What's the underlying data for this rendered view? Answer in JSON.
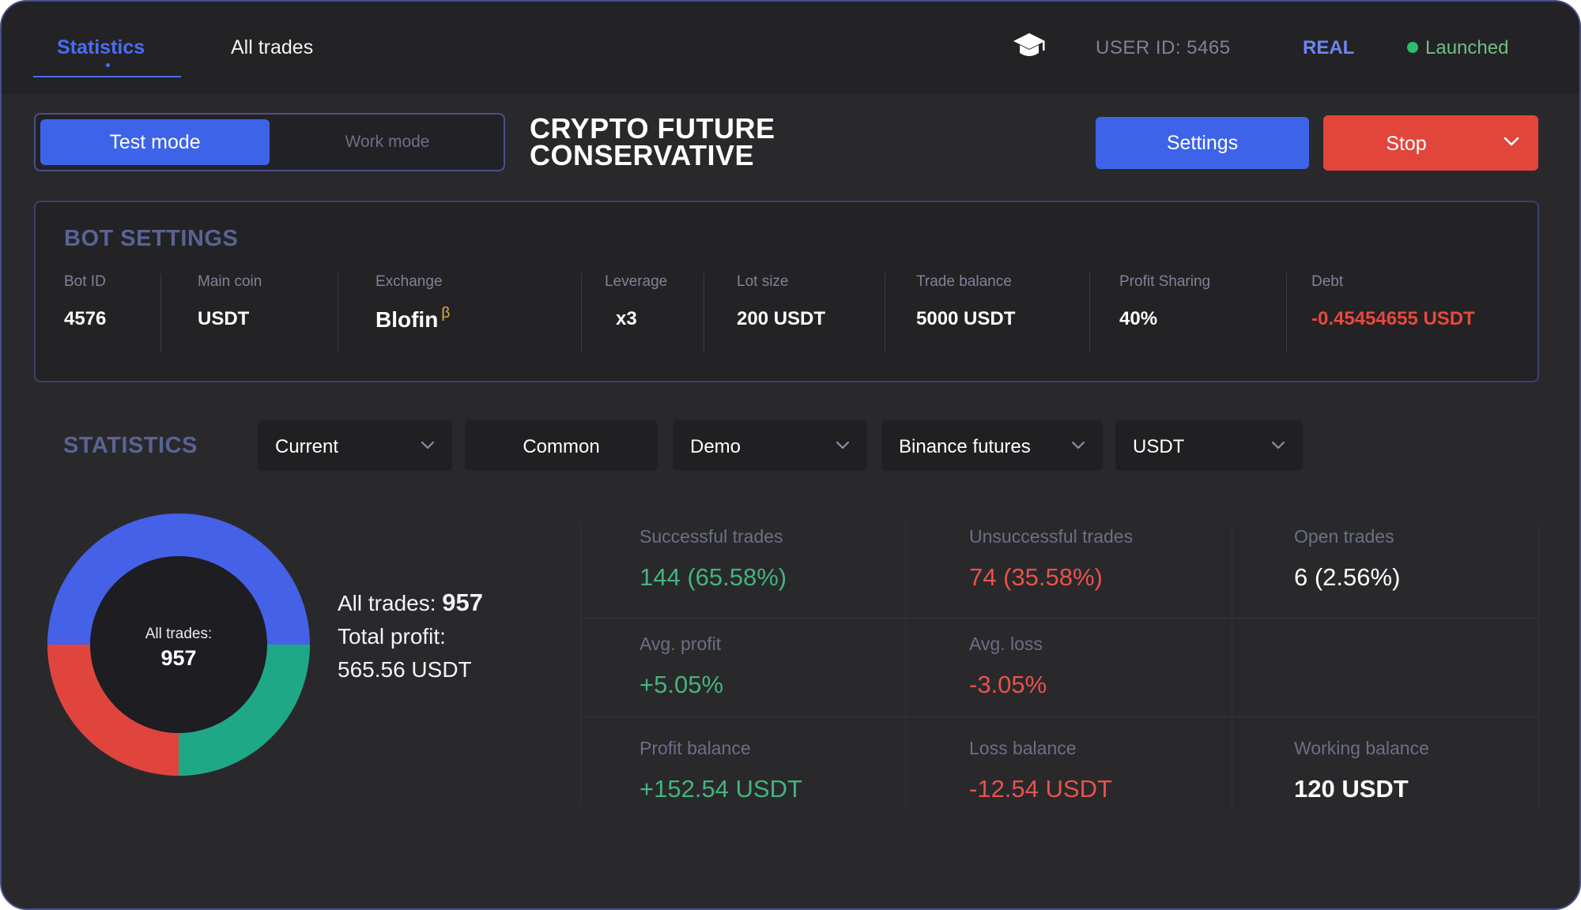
{
  "topbar": {
    "tabs": [
      {
        "label": "Statistics"
      },
      {
        "label": "All trades"
      }
    ],
    "user_id": "USER ID: 5465",
    "account_type": "REAL",
    "status": "Launched",
    "icons": {
      "education": "graduation-cap-icon",
      "status": "status-dot-icon"
    }
  },
  "header": {
    "modes": [
      {
        "label": "Test mode"
      },
      {
        "label": "Work mode"
      }
    ],
    "title_line1": "CRYPTO FUTURE",
    "title_line2": "CONSERVATIVE",
    "settings_label": "Settings",
    "stop_label": "Stop"
  },
  "bot_settings": {
    "title": "BOT SETTINGS",
    "fields": [
      {
        "label": "Bot ID",
        "value": "4576"
      },
      {
        "label": "Main coin",
        "value": "USDT"
      },
      {
        "label": "Exchange",
        "value": "Blofin",
        "badge": "β"
      },
      {
        "label": "Leverage",
        "value": "x3"
      },
      {
        "label": "Lot size",
        "value": "200 USDT"
      },
      {
        "label": "Trade balance",
        "value": "5000 USDT"
      },
      {
        "label": "Profit Sharing",
        "value": "40%"
      },
      {
        "label": "Debt",
        "value": "-0.45454655 USDT"
      }
    ]
  },
  "statistics": {
    "title": "STATISTICS",
    "filters": [
      {
        "label": "Current"
      },
      {
        "label": "Common"
      },
      {
        "label": "Demo"
      },
      {
        "label": "Binance futures"
      },
      {
        "label": "USDT"
      }
    ],
    "donut": {
      "label": "All trades:",
      "value": "957"
    },
    "totals": {
      "all_trades_label": "All trades:",
      "all_trades_value": "957",
      "profit_label": "Total profit:",
      "profit_value": "565.56 USDT"
    },
    "metrics": [
      {
        "label": "Successful trades",
        "value": "144 (65.58%)"
      },
      {
        "label": "Unsuccessful trades",
        "value": "74 (35.58%)"
      },
      {
        "label": "Open trades",
        "value": "6 (2.56%)"
      },
      {
        "label": "Avg. profit",
        "value": "+5.05%"
      },
      {
        "label": "Avg. loss",
        "value": "-3.05%"
      },
      {
        "label": "Profit balance",
        "value": "+152.54 USDT"
      },
      {
        "label": "Loss balance",
        "value": "-12.54 USDT"
      },
      {
        "label": "Working balance",
        "value": "120 USDT"
      }
    ]
  },
  "colors": {
    "accent": "#3d63e8",
    "danger": "#e2463b",
    "success": "#45b37c",
    "donut_blue": "#4561e8",
    "donut_red": "#e0453d",
    "donut_green": "#1fa886"
  }
}
